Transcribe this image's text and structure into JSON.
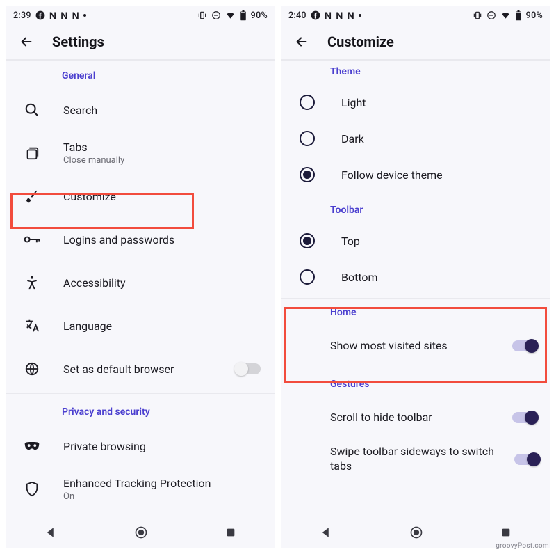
{
  "left": {
    "status": {
      "time": "2:39",
      "battery": "90%"
    },
    "header": {
      "title": "Settings"
    },
    "sections": {
      "general_label": "General",
      "search": "Search",
      "tabs": {
        "title": "Tabs",
        "sub": "Close manually"
      },
      "customize": "Customize",
      "logins": "Logins and passwords",
      "accessibility": "Accessibility",
      "language": "Language",
      "default_browser": "Set as default browser",
      "privacy_label": "Privacy and security",
      "private_browsing": "Private browsing",
      "etp": {
        "title": "Enhanced Tracking Protection",
        "sub": "On"
      }
    }
  },
  "right": {
    "status": {
      "time": "2:40",
      "battery": "90%"
    },
    "header": {
      "title": "Customize"
    },
    "theme": {
      "label": "Theme",
      "light": "Light",
      "dark": "Dark",
      "follow": "Follow device theme"
    },
    "toolbar": {
      "label": "Toolbar",
      "top": "Top",
      "bottom": "Bottom"
    },
    "home": {
      "label": "Home",
      "most_visited": "Show most visited sites"
    },
    "gestures": {
      "label": "Gestures",
      "scroll": "Scroll to hide toolbar",
      "swipe": "Swipe toolbar sideways to switch tabs"
    }
  },
  "watermark": "groovyPost.com"
}
